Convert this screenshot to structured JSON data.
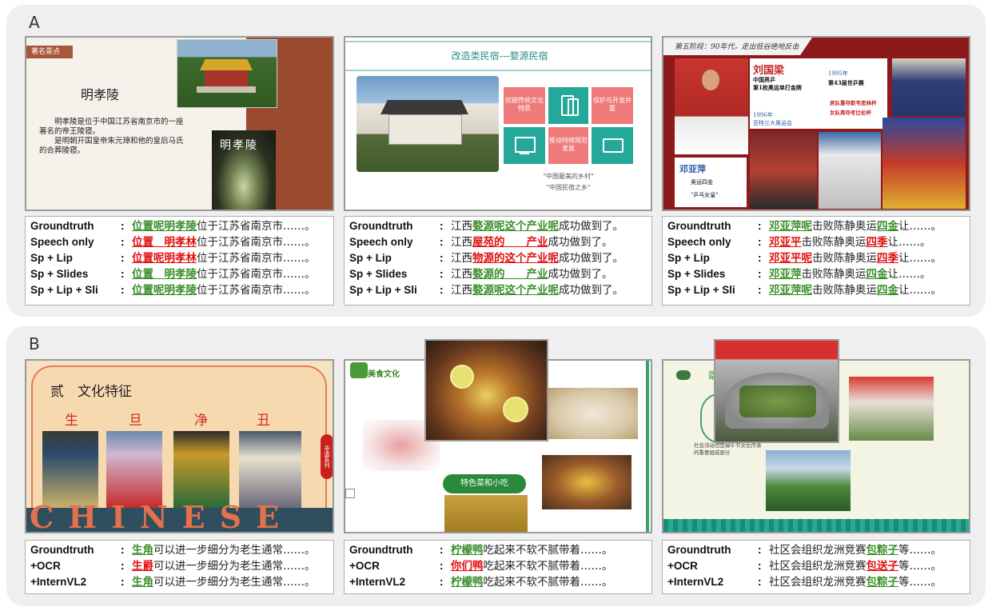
{
  "panels": {
    "a_letter": "A",
    "b_letter": "B"
  },
  "slides": {
    "a1": {
      "tag": "著名景点",
      "title": "明孝陵",
      "para1": "明孝陵是位于中国江苏省南京市的一座著名的帝王陵寝。",
      "para2": "是明朝开国皇帝朱元璋和他的皇后马氏的合葬陵寝。",
      "sign": "明孝陵"
    },
    "a2": {
      "title": "改造类民宿---婺源民宿",
      "box1": "挖掘传统文化特质",
      "box2": "保护与开发并重",
      "box3": "推动持续规范发展",
      "cap1": "\"中国最美的乡村\"",
      "cap2": "\"中国民宿之乡\""
    },
    "a3": {
      "header": "第五阶段：90年代，走出低谷绝地反击",
      "name1": "刘国梁",
      "line1": "中国男乒",
      "line2": "第1枚奥运单打金牌",
      "y1995": "1995年",
      "t1995": "第43届世乒赛",
      "team": "男队重夺斯韦思林杯",
      "women": "女队再夺考比伦杯",
      "y1996": "1996年",
      "t1996": "亚特兰大奥运会",
      "name2": "邓亚萍",
      "d2": "奥运四金",
      "d3": "\"乒乓女皇\""
    },
    "b1": {
      "title": "贰　文化特征",
      "roles": [
        "生",
        "旦",
        "净",
        "丑"
      ],
      "band": "CHINESE",
      "side": "非遗系列"
    },
    "b2": {
      "title": "美食文化",
      "label": "特色菜和小吃"
    },
    "b3": {
      "title": "端",
      "note": "社会活动也是端午节文化传承的重要组成部分"
    }
  },
  "tables": {
    "a1": [
      {
        "label": "Groundtruth",
        "hl": "位置呢明孝陵",
        "cls": "g",
        "rest": "位于江苏省南京市……。"
      },
      {
        "label": "Speech only",
        "hl": "位置　明孝林",
        "cls": "r",
        "rest": "位于江苏省南京市……。"
      },
      {
        "label": "Sp + Lip",
        "hl": "位置呢明孝林",
        "cls": "r",
        "rest": "位于江苏省南京市……。"
      },
      {
        "label": "Sp + Slides",
        "hl": "位置　明孝陵",
        "cls": "g",
        "rest": "位于江苏省南京市……。"
      },
      {
        "label": "Sp + Lip + Sli",
        "hl": "位置呢明孝陵",
        "cls": "g",
        "rest": "位于江苏省南京市……。"
      }
    ],
    "a2": [
      {
        "label": "Groundtruth",
        "pre": "江西",
        "hl": "婺源呢这个产业呢",
        "cls": "g",
        "rest": "成功做到了。"
      },
      {
        "label": "Speech only",
        "pre": "江西",
        "hl": "屋苑的　　产业",
        "cls": "r",
        "rest": "成功做到了。"
      },
      {
        "label": "Sp + Lip",
        "pre": "江西",
        "hl": "物源的这个产业呢",
        "cls": "r",
        "rest": "成功做到了。"
      },
      {
        "label": "Sp + Slides",
        "pre": "江西",
        "hl": "婺源的　　产业",
        "cls": "g",
        "rest": "成功做到了。"
      },
      {
        "label": "Sp + Lip + Sli",
        "pre": "江西",
        "hl": "婺源呢这个产业呢",
        "cls": "g",
        "rest": "成功做到了。"
      }
    ],
    "a3": [
      {
        "label": "Groundtruth",
        "hl": "邓亚萍呢",
        "cls": "g",
        "mid": "击败陈静奥运",
        "hl2": "四金",
        "cls2": "g",
        "rest": "让……。"
      },
      {
        "label": "Speech only",
        "hl": "邓亚平",
        "cls": "r",
        "mid": "击败陈静奥运",
        "hl2": "四季",
        "cls2": "r",
        "rest": "让……。"
      },
      {
        "label": "Sp + Lip",
        "hl": "邓亚平呢",
        "cls": "r",
        "mid": "击败陈静奥运",
        "hl2": "四季",
        "cls2": "r",
        "rest": "让……。"
      },
      {
        "label": "Sp + Slides",
        "hl": "邓亚萍",
        "cls": "g",
        "mid": "击败陈静奥运",
        "hl2": "四金",
        "cls2": "g",
        "rest": "让……。"
      },
      {
        "label": "Sp + Lip + Sli",
        "hl": "邓亚萍呢",
        "cls": "g",
        "mid": "击败陈静奥运",
        "hl2": "四金",
        "cls2": "g",
        "rest": "让……。"
      }
    ],
    "b1": [
      {
        "label": "Groundtruth",
        "hl": "生角",
        "cls": "g",
        "rest": "可以进一步细分为老生通常……。"
      },
      {
        "label": "+OCR",
        "hl": "生爵",
        "cls": "r",
        "rest": "可以进一步细分为老生通常……。"
      },
      {
        "label": "+InternVL2",
        "hl": "生角",
        "cls": "g",
        "rest": "可以进一步细分为老生通常……。"
      }
    ],
    "b2": [
      {
        "label": "Groundtruth",
        "hl": "柠檬鸭",
        "cls": "g",
        "rest": "吃起来不软不腻带着……。"
      },
      {
        "label": "+OCR",
        "hl": "你们鸭",
        "cls": "r",
        "rest": "吃起来不软不腻带着……。"
      },
      {
        "label": "+InternVL2",
        "hl": "柠檬鸭",
        "cls": "g",
        "rest": "吃起来不软不腻带着……。"
      }
    ],
    "b3": [
      {
        "label": "Groundtruth",
        "pre": "社区会组织龙洲竞赛",
        "hl": "包粽子",
        "cls": "g",
        "rest": "等……。"
      },
      {
        "label": "+OCR",
        "pre": "社区会组织龙洲竞赛",
        "hl": "包送子",
        "cls": "r",
        "rest": "等……。"
      },
      {
        "label": "+InternVL2",
        "pre": "社区会组织龙洲竞赛",
        "hl": "包粽子",
        "cls": "g",
        "rest": "等……。"
      }
    ]
  },
  "colors": {
    "correct": "#3a8f2a",
    "error": "#e01010",
    "panel": "#efefef"
  }
}
